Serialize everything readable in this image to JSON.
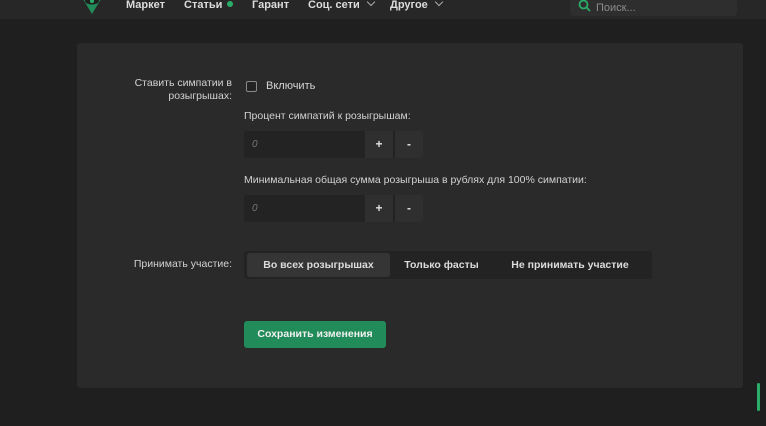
{
  "nav": {
    "items": [
      {
        "label": "Маркет"
      },
      {
        "label": "Статьи"
      },
      {
        "label": "Гарант"
      },
      {
        "label": "Соц. сети"
      },
      {
        "label": "Другое"
      }
    ],
    "search_placeholder": "Поиск..."
  },
  "settings": {
    "likes_label": "Ставить симпатии в розыгрышах:",
    "enable_label": "Включить",
    "enable_checked": false,
    "percent_label": "Процент симпатий к розыгрышам:",
    "percent_placeholder": "0",
    "min_sum_label": "Минимальная общая сумма розыгрыша в рублях для 100% симпатии:",
    "min_sum_placeholder": "0",
    "plus_label": "+",
    "minus_label": "-",
    "participate_label": "Принимать участие:",
    "participate_options": [
      "Во всех розыгрышах",
      "Только фасты",
      "Не принимать участие"
    ],
    "participate_selected": "Во всех розыгрышах",
    "save_label": "Сохранить изменения"
  },
  "colors": {
    "accent": "#218c5a",
    "accent_dot": "#2bad6a",
    "background": "#1f1f1f",
    "panel": "#2a2a2a"
  },
  "icons": [
    "logo-icon",
    "search-icon",
    "chevron-down-icon",
    "status-dot-icon"
  ]
}
